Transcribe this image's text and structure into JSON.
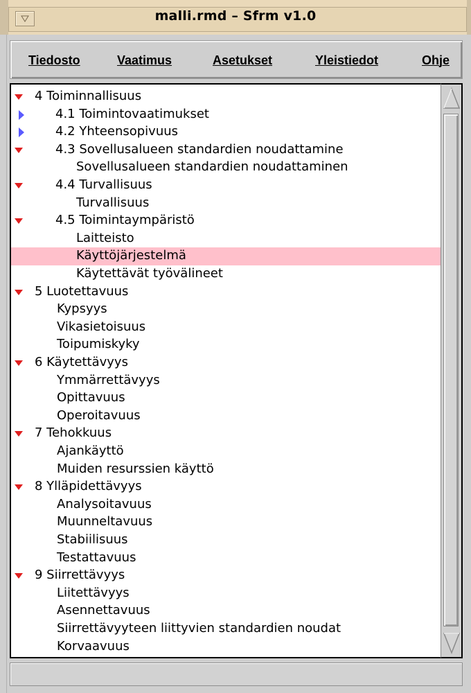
{
  "window": {
    "title": "malli.rmd – Sfrm v1.0"
  },
  "menubar": {
    "items": [
      {
        "label": "Tiedosto"
      },
      {
        "label": "Vaatimus"
      },
      {
        "label": "Asetukset"
      },
      {
        "label": "Yleistiedot"
      },
      {
        "label": "Ohje"
      }
    ]
  },
  "tree": {
    "selected_color": "#ffc0cb",
    "expanded_arrow_color": "#e02020",
    "collapsed_arrow_color": "#5a5aff",
    "rows": [
      {
        "label": "4 Toiminnallisuus",
        "state": "expanded"
      },
      {
        "label": "4.1 Toimintovaatimukset",
        "state": "collapsed"
      },
      {
        "label": "4.2 Yhteensopivuus",
        "state": "collapsed"
      },
      {
        "label": "4.3 Sovellusalueen standardien noudattamine",
        "state": "expanded"
      },
      {
        "label": "Sovellusalueen standardien noudattaminen",
        "state": "leaf"
      },
      {
        "label": "4.4 Turvallisuus",
        "state": "expanded"
      },
      {
        "label": "Turvallisuus",
        "state": "leaf"
      },
      {
        "label": "4.5 Toimintaympäristö",
        "state": "expanded"
      },
      {
        "label": "Laitteisto",
        "state": "leaf"
      },
      {
        "label": "Käyttöjärjestelmä",
        "state": "leaf",
        "selected": true
      },
      {
        "label": "Käytettävät työvälineet",
        "state": "leaf"
      },
      {
        "label": "5 Luotettavuus",
        "state": "expanded"
      },
      {
        "label": "Kypsyys",
        "state": "leaf"
      },
      {
        "label": "Vikasietoisuus",
        "state": "leaf"
      },
      {
        "label": "Toipumiskyky",
        "state": "leaf"
      },
      {
        "label": "6 Käytettävyys",
        "state": "expanded"
      },
      {
        "label": "Ymmärrettävyys",
        "state": "leaf"
      },
      {
        "label": "Opittavuus",
        "state": "leaf"
      },
      {
        "label": "Operoitavuus",
        "state": "leaf"
      },
      {
        "label": "7 Tehokkuus",
        "state": "expanded"
      },
      {
        "label": "Ajankäyttö",
        "state": "leaf"
      },
      {
        "label": "Muiden resurssien käyttö",
        "state": "leaf"
      },
      {
        "label": "8 Ylläpidettävyys",
        "state": "expanded"
      },
      {
        "label": "Analysoitavuus",
        "state": "leaf"
      },
      {
        "label": "Muunneltavuus",
        "state": "leaf"
      },
      {
        "label": "Stabiilisuus",
        "state": "leaf"
      },
      {
        "label": "Testattavuus",
        "state": "leaf"
      },
      {
        "label": "9 Siirrettävyys",
        "state": "expanded"
      },
      {
        "label": "Liitettävyys",
        "state": "leaf"
      },
      {
        "label": "Asennettavuus",
        "state": "leaf"
      },
      {
        "label": "Siirrettävyyteen liittyvien standardien noudat",
        "state": "leaf"
      },
      {
        "label": "Korvaavuus",
        "state": "leaf"
      }
    ]
  },
  "statusbar": {
    "text": ""
  }
}
